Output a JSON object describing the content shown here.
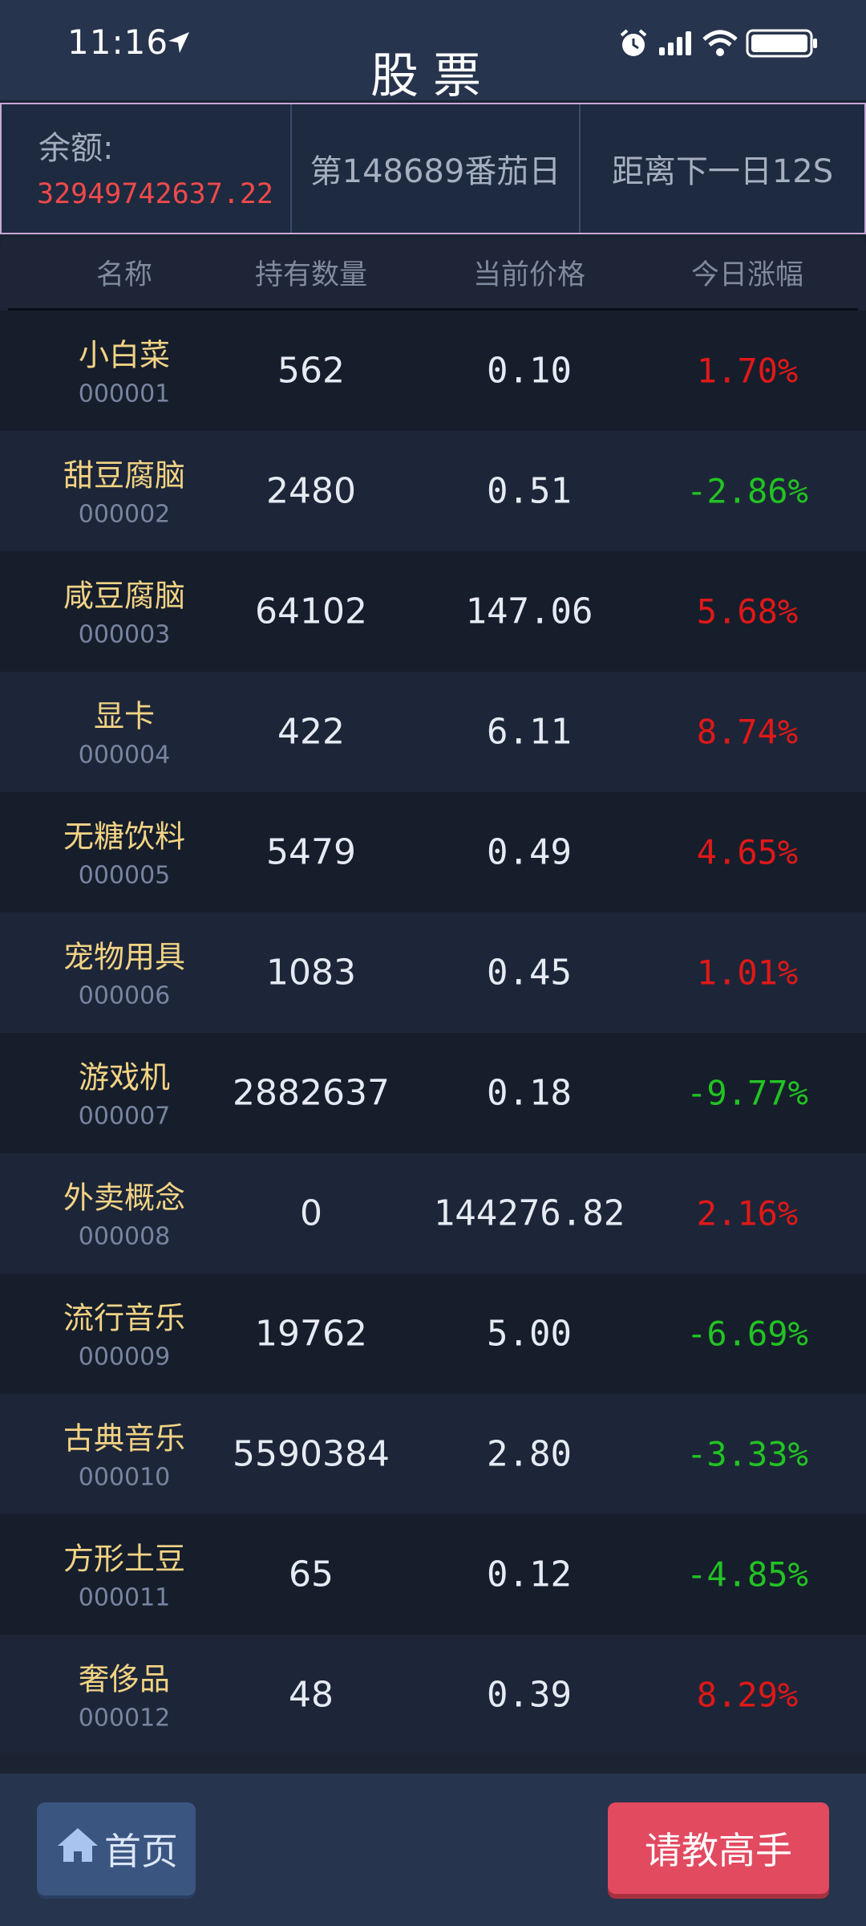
{
  "status_bar": {
    "time": "11:16"
  },
  "app": {
    "title": "股票"
  },
  "info": {
    "balance_label": "余额:",
    "balance_value": "32949742637.22",
    "day_text": "第148689番茄日",
    "next_day_text": "距离下一日12S"
  },
  "table": {
    "headers": [
      "名称",
      "持有数量",
      "当前价格",
      "今日涨幅"
    ],
    "rows": [
      {
        "name": "小白菜",
        "code": "000001",
        "qty": "562",
        "price": "0.10",
        "change": "1.70%",
        "dir": "up"
      },
      {
        "name": "甜豆腐脑",
        "code": "000002",
        "qty": "2480",
        "price": "0.51",
        "change": "-2.86%",
        "dir": "down"
      },
      {
        "name": "咸豆腐脑",
        "code": "000003",
        "qty": "64102",
        "price": "147.06",
        "change": "5.68%",
        "dir": "up"
      },
      {
        "name": "显卡",
        "code": "000004",
        "qty": "422",
        "price": "6.11",
        "change": "8.74%",
        "dir": "up"
      },
      {
        "name": "无糖饮料",
        "code": "000005",
        "qty": "5479",
        "price": "0.49",
        "change": "4.65%",
        "dir": "up"
      },
      {
        "name": "宠物用具",
        "code": "000006",
        "qty": "1083",
        "price": "0.45",
        "change": "1.01%",
        "dir": "up"
      },
      {
        "name": "游戏机",
        "code": "000007",
        "qty": "2882637",
        "price": "0.18",
        "change": "-9.77%",
        "dir": "down"
      },
      {
        "name": "外卖概念",
        "code": "000008",
        "qty": "0",
        "price": "144276.82",
        "change": "2.16%",
        "dir": "up"
      },
      {
        "name": "流行音乐",
        "code": "000009",
        "qty": "19762",
        "price": "5.00",
        "change": "-6.69%",
        "dir": "down"
      },
      {
        "name": "古典音乐",
        "code": "000010",
        "qty": "5590384",
        "price": "2.80",
        "change": "-3.33%",
        "dir": "down"
      },
      {
        "name": "方形土豆",
        "code": "000011",
        "qty": "65",
        "price": "0.12",
        "change": "-4.85%",
        "dir": "down"
      },
      {
        "name": "奢侈品",
        "code": "000012",
        "qty": "48",
        "price": "0.39",
        "change": "8.29%",
        "dir": "up"
      }
    ]
  },
  "bottom": {
    "home_label": "首页",
    "ask_label": "请教高手"
  },
  "colors": {
    "up": "#e01818",
    "down": "#22c322",
    "name": "#f2d384",
    "balance": "#ef4a4a"
  }
}
